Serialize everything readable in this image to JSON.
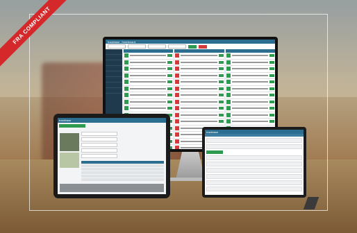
{
  "ribbon": {
    "text": "FRA COMPLIANT"
  },
  "monitor": {
    "brand": "trackbase",
    "title": "Dashboard"
  },
  "tablet_left": {
    "brand": "trackbase"
  },
  "tablet_right": {
    "brand": "trackbase"
  },
  "colors": {
    "primary": "#2c6e8f",
    "success": "#2e9b50",
    "danger": "#d43a3a",
    "ribbon": "#d4282a"
  }
}
